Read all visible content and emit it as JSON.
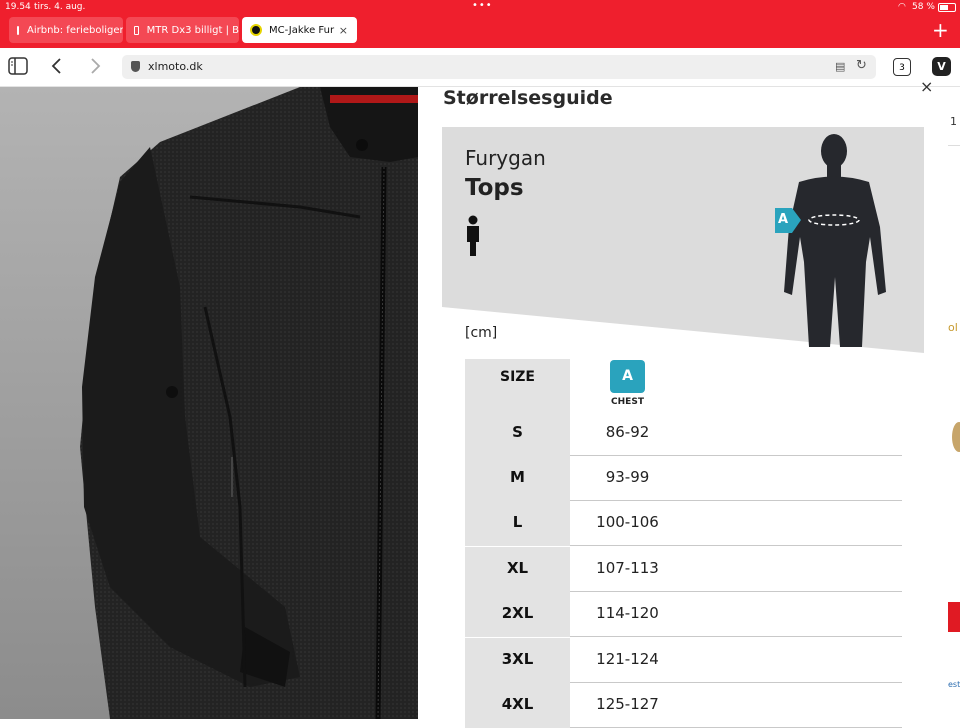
{
  "status": {
    "time": "19.54",
    "date": "tirs. 4. aug.",
    "battery": "58 %"
  },
  "tabs": [
    {
      "label": "Airbnb: ferieboliger"
    },
    {
      "label": "MTR Dx3 billigt | B"
    },
    {
      "label": "MC-Jakke Fur",
      "close": "×"
    }
  ],
  "toolbar": {
    "url": "xlmoto.dk",
    "tab_count": "3",
    "new_tab": "+"
  },
  "page_right_fragments": [
    "1",
    "ol",
    "est"
  ],
  "modal": {
    "title": "Størrelsesguide",
    "close": "×",
    "brand": "Furygan",
    "category": "Tops",
    "marker": "A",
    "unit": "[cm]",
    "table": {
      "size_header": "SIZE",
      "measure_badge": "A",
      "measure_label": "CHEST",
      "rows": [
        {
          "size": "S",
          "chest": "86-92"
        },
        {
          "size": "M",
          "chest": "93-99"
        },
        {
          "size": "L",
          "chest": "100-106"
        },
        {
          "size": "XL",
          "chest": "107-113"
        },
        {
          "size": "2XL",
          "chest": "114-120"
        },
        {
          "size": "3XL",
          "chest": "121-124"
        },
        {
          "size": "4XL",
          "chest": "125-127"
        }
      ]
    }
  },
  "colors": {
    "brand_red": "#ef1f2d",
    "accent_teal": "#2aa3bd",
    "hero_gray": "#dcdcdc",
    "silhouette": "#26282d"
  },
  "icons": [
    "sidebar-icon",
    "back-icon",
    "forward-icon",
    "shield-icon",
    "reader-icon",
    "reload-icon",
    "vivaldi-icon",
    "person-icon",
    "body-silhouette-icon"
  ]
}
